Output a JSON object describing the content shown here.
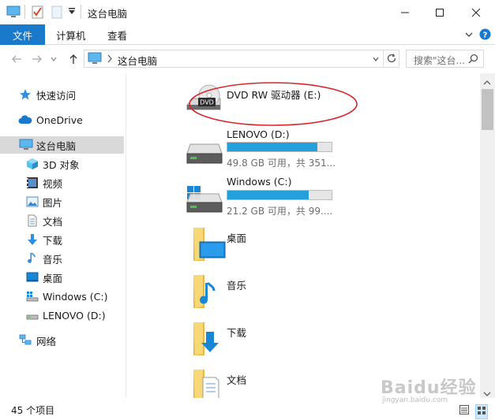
{
  "window": {
    "title": "这台电脑"
  },
  "ribbon": {
    "tabs": [
      "文件",
      "计算机",
      "查看"
    ]
  },
  "address": {
    "path": "这台电脑",
    "search_placeholder": "搜索\"这台..."
  },
  "sidebar": {
    "items": [
      {
        "label": "快速访问",
        "icon": "star-icon"
      },
      {
        "label": "OneDrive",
        "icon": "cloud-icon"
      },
      {
        "label": "这台电脑",
        "icon": "computer-icon",
        "selected": true
      },
      {
        "label": "3D 对象",
        "icon": "cube-icon"
      },
      {
        "label": "视频",
        "icon": "video-icon"
      },
      {
        "label": "图片",
        "icon": "picture-icon"
      },
      {
        "label": "文档",
        "icon": "document-icon"
      },
      {
        "label": "下载",
        "icon": "download-icon"
      },
      {
        "label": "音乐",
        "icon": "music-icon"
      },
      {
        "label": "桌面",
        "icon": "desktop-icon"
      },
      {
        "label": "Windows (C:)",
        "icon": "drive-c-icon"
      },
      {
        "label": "LENOVO (D:)",
        "icon": "drive-d-icon"
      },
      {
        "label": "网络",
        "icon": "network-icon"
      }
    ]
  },
  "drives": [
    {
      "name": "DVD RW 驱动器 (E:)",
      "icon": "dvd-drive-icon",
      "dvd_label": "DVD"
    },
    {
      "name": "LENOVO (D:)",
      "icon": "hard-drive-icon",
      "info": "49.8 GB 可用，共 351...",
      "used_fraction": 0.86
    },
    {
      "name": "Windows (C:)",
      "icon": "windows-drive-icon",
      "info": "21.2 GB 可用，共 99....",
      "used_fraction": 0.78
    }
  ],
  "folders": [
    {
      "name": "桌面",
      "icon": "desktop-folder-icon"
    },
    {
      "name": "音乐",
      "icon": "music-folder-icon"
    },
    {
      "name": "下载",
      "icon": "download-folder-icon"
    },
    {
      "name": "文档",
      "icon": "documents-folder-icon"
    }
  ],
  "status": {
    "item_count": "45 个项目"
  },
  "watermark": {
    "main": "Baidu经验",
    "sub": "jingyan.baidu.com"
  },
  "colors": {
    "accent": "#1979ca",
    "drive_fill": "#26a0da",
    "annotation": "#d9252b",
    "selected_bg": "#d9d9d9"
  }
}
